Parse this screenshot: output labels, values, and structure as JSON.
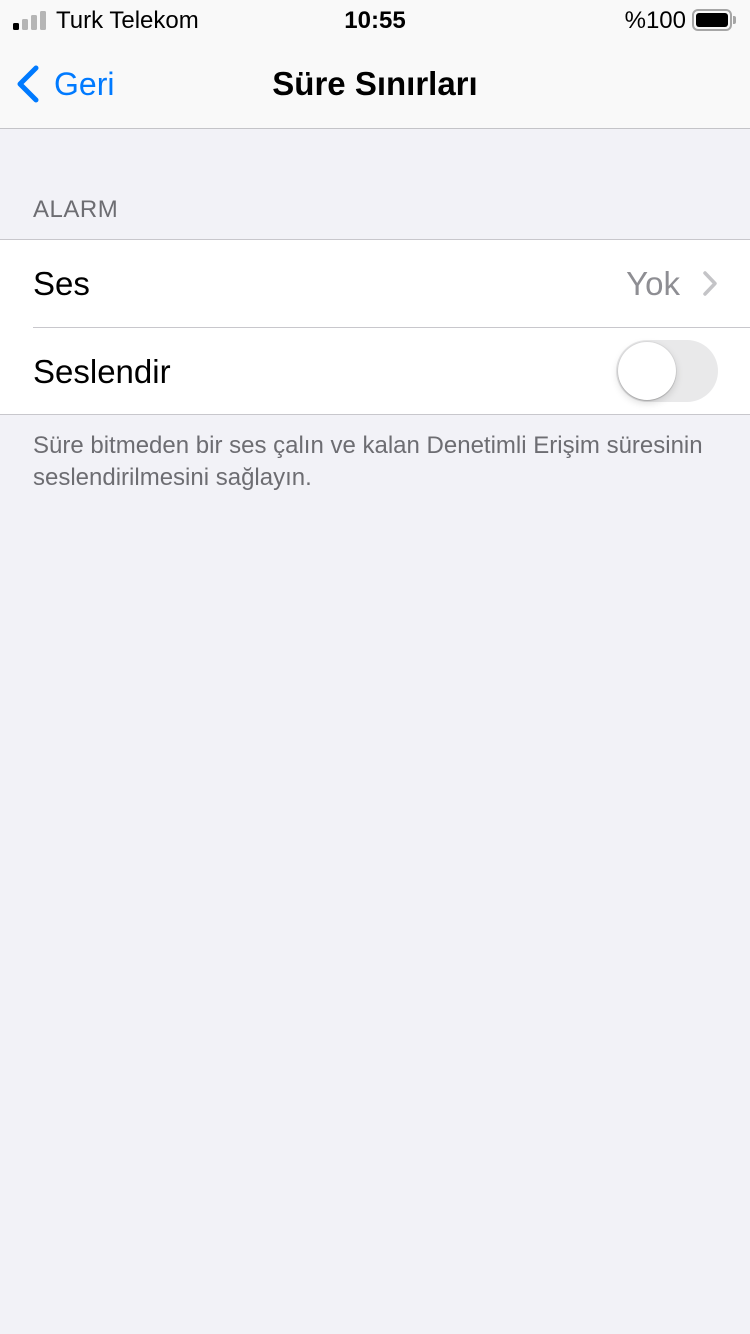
{
  "status_bar": {
    "carrier": "Turk Telekom",
    "time": "10:55",
    "battery_percent": "%100",
    "signal_bars_active": 1,
    "signal_bars_total": 4
  },
  "nav": {
    "back_label": "Geri",
    "title": "Süre Sınırları"
  },
  "section": {
    "header": "ALARM",
    "rows": [
      {
        "label": "Ses",
        "value": "Yok"
      },
      {
        "label": "Seslendir",
        "toggle_on": false
      }
    ],
    "footer": "Süre bitmeden bir ses çalın ve kalan Denetimli Erişim süresinin seslendirilmesini sağlayın."
  },
  "colors": {
    "accent": "#007aff",
    "background": "#f2f2f7",
    "secondary_text": "#6d6d72",
    "toggle_off_track": "#e9e9ea"
  }
}
